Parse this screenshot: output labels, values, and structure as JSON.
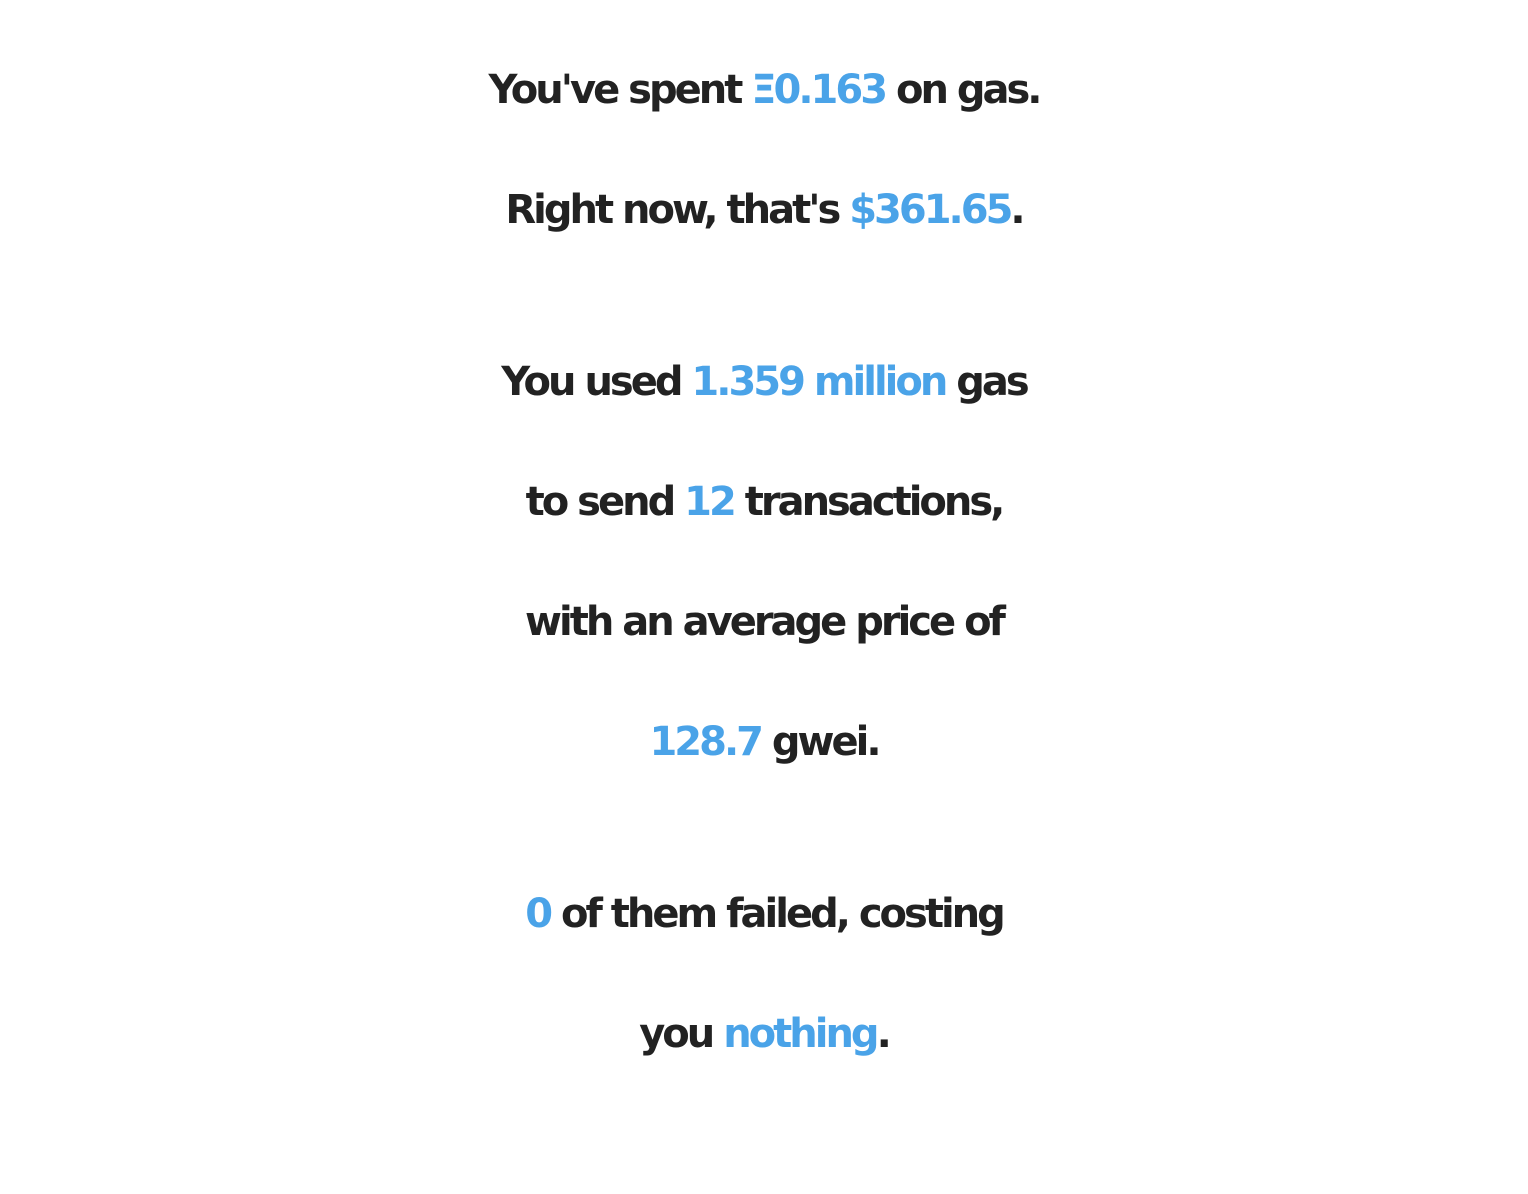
{
  "colors": {
    "text": "#222222",
    "highlight": "#4aa3e8",
    "background": "#ffffff"
  },
  "summary": {
    "p1": {
      "line1_pre": "You've spent ",
      "eth_spent": "Ξ0.163",
      "line1_post": " on gas.",
      "line2_pre": "Right now, that's ",
      "usd_value": "$361.65",
      "line2_post": "."
    },
    "p2": {
      "line1_pre": "You used ",
      "gas_used": "1.359 million",
      "line1_post": " gas",
      "line2_pre": "to send ",
      "tx_count": "12",
      "line2_post": " transactions,",
      "line3": "with an average price of",
      "avg_price": "128.7",
      "line4_post": " gwei."
    },
    "p3": {
      "failed_count": "0",
      "line1_post": " of them failed, costing",
      "line2_pre": "you ",
      "failed_cost": "nothing",
      "line2_post": "."
    }
  }
}
